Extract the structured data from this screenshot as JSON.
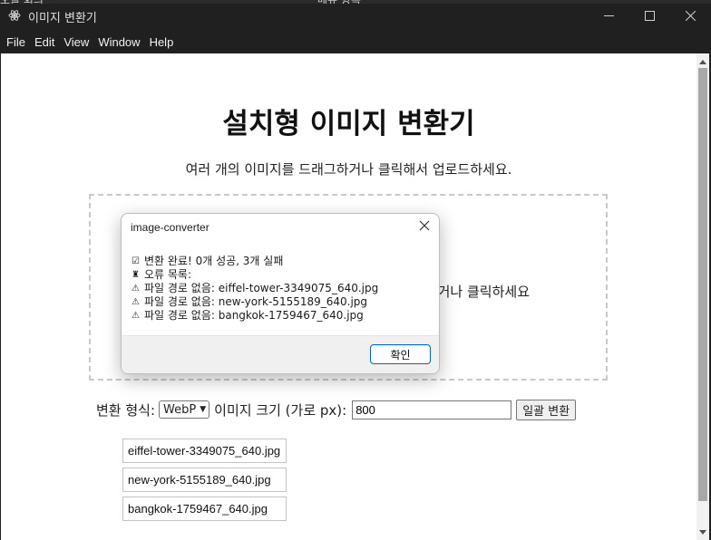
{
  "window": {
    "title": "이미지 변환기",
    "menu": [
      "File",
      "Edit",
      "View",
      "Window",
      "Help"
    ]
  },
  "page": {
    "title": "설치형 이미지 변환기",
    "subtitle": "여러 개의 이미지를 드래그하거나 클릭해서 업로드하세요.",
    "dropzone_text": "여러 개의 이미지를 드래그하거나 클릭하세요."
  },
  "controls": {
    "format_label": "변환 형식:",
    "format_value": "WebP",
    "width_label": "이미지 크기 (가로 px):",
    "width_value": "800",
    "convert_label": "일괄 변환"
  },
  "files": [
    "eiffel-tower-3349075_640.jpg",
    "new-york-5155189_640.jpg",
    "bangkok-1759467_640.jpg"
  ],
  "dialog": {
    "title": "image-converter",
    "lines": [
      {
        "icon": "☑",
        "text": "변환 완료! 0개 성공, 3개 실패"
      },
      {
        "icon": "♜",
        "text": "오류 목록:"
      },
      {
        "icon": "⚠",
        "text": "파일 경로 없음: eiffel-tower-3349075_640.jpg"
      },
      {
        "icon": "⚠",
        "text": "파일 경로 없음: new-york-5155189_640.jpg"
      },
      {
        "icon": "⚠",
        "text": "파일 경로 없음: bangkok-1759467_640.jpg"
      }
    ],
    "ok_label": "확인"
  }
}
